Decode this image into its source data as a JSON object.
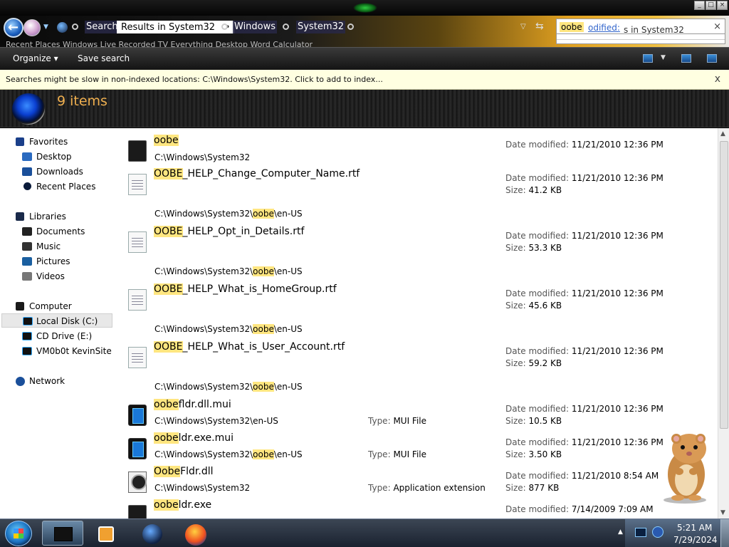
{
  "window": {
    "controls": [
      "minimize",
      "maximize",
      "close"
    ]
  },
  "address": {
    "crumbs": [
      {
        "label": "Search"
      },
      {
        "label": "Results in System32"
      },
      {
        "label": "Windows"
      },
      {
        "label": "System32"
      }
    ],
    "dot": "•",
    "ghost_text": "Recent Places  Windows Live  Recorded TV  Everything  Desktop  Word  Calculator"
  },
  "search": {
    "query": "oobe",
    "filter_link": "odified:",
    "tail_text": "s in System32",
    "clear_glyph": "×"
  },
  "toolbar": {
    "organize": "Organize",
    "save_search": "Save search"
  },
  "infobar": {
    "message": "Searches might be slow in non-indexed locations: C:\\Windows\\System32. Click to add to index...",
    "close_glyph": "x"
  },
  "header": {
    "item_count": "9 items"
  },
  "nav": {
    "favorites": {
      "label": "Favorites",
      "items": [
        "Desktop",
        "Downloads",
        "Recent Places"
      ]
    },
    "libraries": {
      "label": "Libraries",
      "items": [
        "Documents",
        "Music",
        "Pictures",
        "Videos"
      ]
    },
    "computer": {
      "label": "Computer",
      "items": [
        "Local Disk (C:)",
        "CD Drive (E:)",
        "VM0b0t KevinSite"
      ]
    },
    "network": {
      "label": "Network"
    }
  },
  "labels": {
    "date_modified": "Date modified:",
    "size": "Size:",
    "type": "Type:"
  },
  "files": [
    {
      "hl": "oobe",
      "rest": "",
      "path": "C:\\Windows\\System32",
      "date": "11/21/2010 12:36 PM",
      "size": "",
      "type": "",
      "icon": "black"
    },
    {
      "hl": "OOBE",
      "rest": "_HELP_Change_Computer_Name.rtf",
      "path": "",
      "date": "11/21/2010 12:36 PM",
      "size": "41.2 KB",
      "type": "",
      "icon": "doc",
      "subpath": {
        "pre": "C:\\Windows\\System32\\",
        "hl": "oobe",
        "post": "\\en-US"
      }
    },
    {
      "hl": "OOBE",
      "rest": "_HELP_Opt_in_Details.rtf",
      "path": "",
      "date": "11/21/2010 12:36 PM",
      "size": "53.3 KB",
      "type": "",
      "icon": "doc",
      "subpath": {
        "pre": "C:\\Windows\\System32\\",
        "hl": "oobe",
        "post": "\\en-US"
      }
    },
    {
      "hl": "OOBE",
      "rest": "_HELP_What_is_HomeGroup.rtf",
      "path": "",
      "date": "11/21/2010 12:36 PM",
      "size": "45.6 KB",
      "type": "",
      "icon": "doc",
      "subpath": {
        "pre": "C:\\Windows\\System32\\",
        "hl": "oobe",
        "post": "\\en-US"
      }
    },
    {
      "hl": "OOBE",
      "rest": "_HELP_What_is_User_Account.rtf",
      "path": "",
      "date": "11/21/2010 12:36 PM",
      "size": "59.2 KB",
      "type": "",
      "icon": "doc",
      "subpath": {
        "pre": "C:\\Windows\\System32\\",
        "hl": "oobe",
        "post": "\\en-US"
      }
    },
    {
      "hl": "oobe",
      "rest": "fldr.dll.mui",
      "path": "C:\\Windows\\System32\\en-US",
      "date": "11/21/2010 12:36 PM",
      "size": "10.5 KB",
      "type": "MUI File",
      "icon": "mui"
    },
    {
      "hl": "oobe",
      "rest": "ldr.exe.mui",
      "path_pre": "C:\\Windows\\System32\\",
      "path_hl": "oobe",
      "path_post": "\\en-US",
      "date": "11/21/2010 12:36 PM",
      "size": "3.50 KB",
      "type": "MUI File",
      "icon": "mui"
    },
    {
      "hl": "Oobe",
      "rest": "Fldr.dll",
      "path": "C:\\Windows\\System32",
      "date": "11/21/2010 8:54 AM",
      "size": "877 KB",
      "type": "Application extension",
      "icon": "dll"
    },
    {
      "hl": "oobe",
      "rest": "ldr.exe",
      "path": "",
      "date": "7/14/2009 7:09 AM",
      "size": "",
      "type": "",
      "icon": "black"
    }
  ],
  "taskbar": {
    "time": "5:21 AM",
    "date": "7/29/2024"
  }
}
